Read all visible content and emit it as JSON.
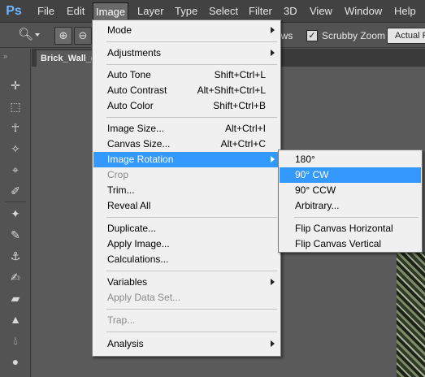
{
  "app": {
    "logo": "Ps"
  },
  "menubar": {
    "items": [
      "File",
      "Edit",
      "Image",
      "Layer",
      "Type",
      "Select",
      "Filter",
      "3D",
      "View",
      "Window",
      "Help"
    ]
  },
  "options_bar": {
    "partial_label": "ows",
    "scrubby_zoom_label": "Scrubby Zoom",
    "scrubby_zoom_checked": true,
    "actual_pixels_label": "Actual P"
  },
  "document": {
    "tab_title": "Brick_Wall_("
  },
  "image_menu": {
    "items": [
      {
        "label": "Mode",
        "shortcut": "",
        "submenu": true,
        "enabled": true
      },
      {
        "label": "Adjustments",
        "shortcut": "",
        "submenu": true,
        "enabled": true
      },
      {
        "label": "Auto Tone",
        "shortcut": "Shift+Ctrl+L",
        "enabled": true
      },
      {
        "label": "Auto Contrast",
        "shortcut": "Alt+Shift+Ctrl+L",
        "enabled": true
      },
      {
        "label": "Auto Color",
        "shortcut": "Shift+Ctrl+B",
        "enabled": true
      },
      {
        "label": "Image Size...",
        "shortcut": "Alt+Ctrl+I",
        "enabled": true
      },
      {
        "label": "Canvas Size...",
        "shortcut": "Alt+Ctrl+C",
        "enabled": true
      },
      {
        "label": "Image Rotation",
        "shortcut": "",
        "submenu": true,
        "enabled": true,
        "highlighted": true
      },
      {
        "label": "Crop",
        "shortcut": "",
        "enabled": false
      },
      {
        "label": "Trim...",
        "shortcut": "",
        "enabled": true
      },
      {
        "label": "Reveal All",
        "shortcut": "",
        "enabled": true
      },
      {
        "label": "Duplicate...",
        "shortcut": "",
        "enabled": true
      },
      {
        "label": "Apply Image...",
        "shortcut": "",
        "enabled": true
      },
      {
        "label": "Calculations...",
        "shortcut": "",
        "enabled": true
      },
      {
        "label": "Variables",
        "shortcut": "",
        "submenu": true,
        "enabled": true
      },
      {
        "label": "Apply Data Set...",
        "shortcut": "",
        "enabled": false
      },
      {
        "label": "Trap...",
        "shortcut": "",
        "enabled": false
      },
      {
        "label": "Analysis",
        "shortcut": "",
        "submenu": true,
        "enabled": true
      }
    ]
  },
  "rotation_submenu": {
    "items": [
      {
        "label": "180°",
        "highlighted": false
      },
      {
        "label": "90° CW",
        "highlighted": true
      },
      {
        "label": "90° CCW",
        "highlighted": false
      },
      {
        "label": "Arbitrary...",
        "highlighted": false
      },
      {
        "label": "Flip Canvas Horizontal",
        "highlighted": false
      },
      {
        "label": "Flip Canvas Vertical",
        "highlighted": false
      }
    ]
  },
  "colors": {
    "highlight": "#3399ff",
    "menubar_bg": "#424242",
    "workspace_bg": "#535353"
  }
}
